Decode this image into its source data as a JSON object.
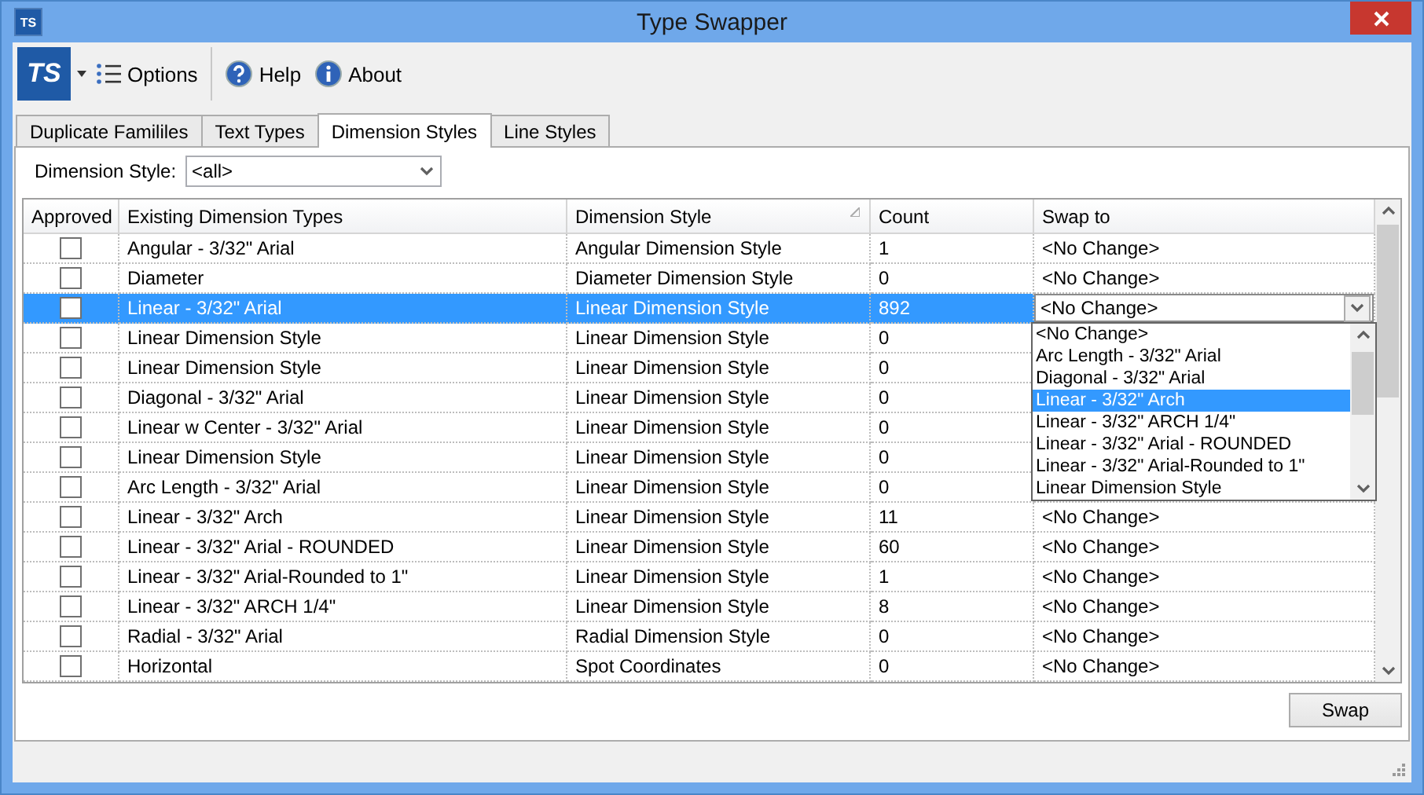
{
  "window": {
    "title": "Type Swapper",
    "icon": "TS"
  },
  "toolbar": {
    "logo": "TS",
    "items": [
      {
        "kind": "options",
        "label": "Options"
      },
      {
        "kind": "help",
        "label": "Help"
      },
      {
        "kind": "about",
        "label": "About"
      }
    ]
  },
  "tabs": [
    {
      "label": "Duplicate Famililes",
      "selected": false
    },
    {
      "label": "Text Types",
      "selected": false
    },
    {
      "label": "Dimension Styles",
      "selected": true
    },
    {
      "label": "Line Styles",
      "selected": false
    }
  ],
  "filter": {
    "label": "Dimension Style:",
    "value": "<all>"
  },
  "grid": {
    "columns": [
      {
        "label": "Approved",
        "sorted": false
      },
      {
        "label": "Existing Dimension Types",
        "sorted": false
      },
      {
        "label": "Dimension Style",
        "sorted": true
      },
      {
        "label": "Count",
        "sorted": false
      },
      {
        "label": "Swap to",
        "sorted": false
      }
    ],
    "rows": [
      {
        "approved": false,
        "type": "Angular - 3/32\" Arial",
        "style": "Angular Dimension Style",
        "count": "1",
        "swap_to": "<No Change>",
        "selected": false
      },
      {
        "approved": false,
        "type": "Diameter",
        "style": "Diameter Dimension Style",
        "count": "0",
        "swap_to": "<No Change>",
        "selected": false
      },
      {
        "approved": false,
        "type": "Linear - 3/32\" Arial",
        "style": "Linear Dimension Style",
        "count": "892",
        "swap_to": "<No Change>",
        "selected": true,
        "dropdown": [
          {
            "label": "<No Change>",
            "selected": false
          },
          {
            "label": "Arc Length - 3/32\" Arial",
            "selected": false
          },
          {
            "label": "Diagonal - 3/32\" Arial",
            "selected": false
          },
          {
            "label": "Linear - 3/32\" Arch",
            "selected": true
          },
          {
            "label": "Linear - 3/32\" ARCH 1/4\"",
            "selected": false
          },
          {
            "label": "Linear - 3/32\" Arial - ROUNDED",
            "selected": false
          },
          {
            "label": "Linear - 3/32\" Arial-Rounded to 1\"",
            "selected": false
          },
          {
            "label": "Linear Dimension Style",
            "selected": false
          }
        ]
      },
      {
        "approved": false,
        "type": "Linear Dimension Style",
        "style": "Linear Dimension Style",
        "count": "0",
        "selected": false
      },
      {
        "approved": false,
        "type": "Linear Dimension Style",
        "style": "Linear Dimension Style",
        "count": "0",
        "selected": false
      },
      {
        "approved": false,
        "type": "Diagonal - 3/32\" Arial",
        "style": "Linear Dimension Style",
        "count": "0",
        "selected": false
      },
      {
        "approved": false,
        "type": "Linear w Center - 3/32\" Arial",
        "style": "Linear Dimension Style",
        "count": "0",
        "selected": false
      },
      {
        "approved": false,
        "type": "Linear Dimension Style",
        "style": "Linear Dimension Style",
        "count": "0",
        "selected": false
      },
      {
        "approved": false,
        "type": "Arc Length - 3/32\" Arial",
        "style": "Linear Dimension Style",
        "count": "0",
        "selected": false
      },
      {
        "approved": false,
        "type": "Linear - 3/32\" Arch",
        "style": "Linear Dimension Style",
        "count": "11",
        "swap_to": "<No Change>",
        "selected": false
      },
      {
        "approved": false,
        "type": "Linear - 3/32\" Arial - ROUNDED",
        "style": "Linear Dimension Style",
        "count": "60",
        "swap_to": "<No Change>",
        "selected": false
      },
      {
        "approved": false,
        "type": "Linear - 3/32\" Arial-Rounded to 1\"",
        "style": "Linear Dimension Style",
        "count": "1",
        "swap_to": "<No Change>",
        "selected": false
      },
      {
        "approved": false,
        "type": "Linear - 3/32\" ARCH 1/4\"",
        "style": "Linear Dimension Style",
        "count": "8",
        "swap_to": "<No Change>",
        "selected": false
      },
      {
        "approved": false,
        "type": "Radial - 3/32\" Arial",
        "style": "Radial Dimension Style",
        "count": "0",
        "swap_to": "<No Change>",
        "selected": false
      },
      {
        "approved": false,
        "type": "Horizontal",
        "style": "Spot Coordinates",
        "count": "0",
        "swap_to": "<No Change>",
        "selected": false
      }
    ]
  },
  "buttons": [
    {
      "label": "Swap"
    }
  ]
}
